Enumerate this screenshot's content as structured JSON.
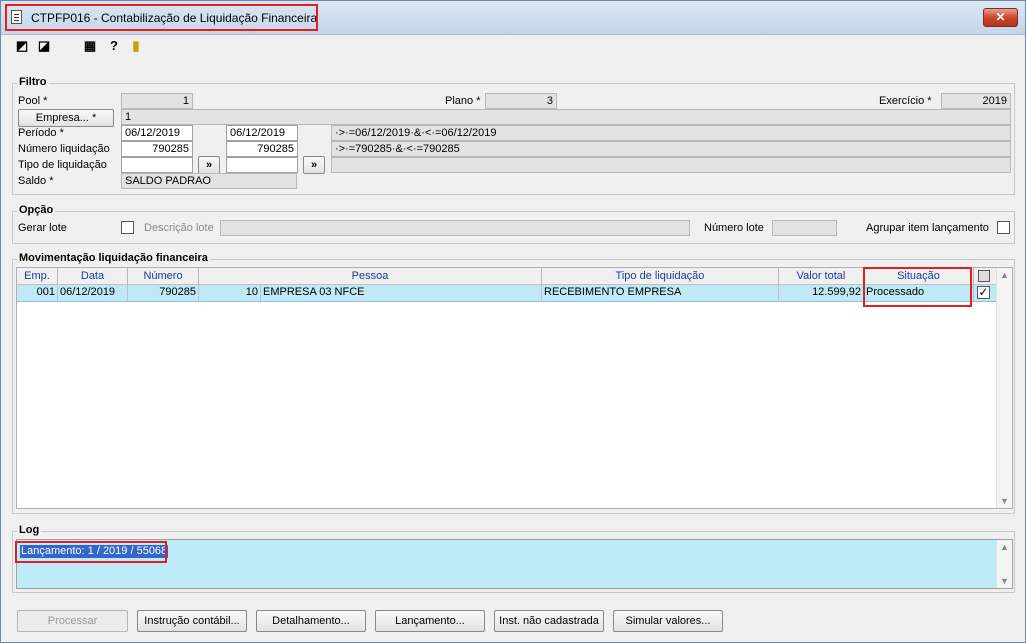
{
  "window": {
    "title": "CTPFP016 - Contabilização de Liquidação Financeira",
    "close_label": "✕"
  },
  "filtro": {
    "title": "Filtro",
    "pool_label": "Pool *",
    "pool_value": "1",
    "plano_label": "Plano *",
    "plano_value": "3",
    "exercicio_label": "Exercício *",
    "exercicio_value": "2019",
    "empresa_button": "Empresa... *",
    "empresa_value": "1",
    "periodo_label": "Período *",
    "periodo_from": "06/12/2019",
    "periodo_to": "06/12/2019",
    "periodo_expr": "·>·=06/12/2019·&·<·=06/12/2019",
    "numero_label": "Número liquidação",
    "numero_from": "790285",
    "numero_to": "790285",
    "numero_expr": "·>·=790285·&·<·=790285",
    "tipo_label": "Tipo de liquidação",
    "tipo_from": "",
    "tipo_to": "",
    "picker_label": "»",
    "saldo_label": "Saldo *",
    "saldo_value": "SALDO PADRAO"
  },
  "opcao": {
    "title": "Opção",
    "gerar_lote_label": "Gerar lote",
    "descricao_lote_label": "Descrição lote",
    "descricao_lote_value": "",
    "numero_lote_label": "Número lote",
    "numero_lote_value": "",
    "agrupar_label": "Agrupar item lançamento"
  },
  "movimentacao": {
    "title": "Movimentação liquidação financeira",
    "columns": [
      "Emp.",
      "Data",
      "Número",
      "Pessoa",
      "Tipo de liquidação",
      "Valor total",
      "Situação"
    ],
    "rows": [
      {
        "emp": "001",
        "data": "06/12/2019",
        "numero": "790285",
        "pessoa_cod": "10",
        "pessoa_nome": "EMPRESA 03 NFCE",
        "tipo": "RECEBIMENTO EMPRESA",
        "valor": "12.599,92",
        "situacao": "Processado",
        "checked": "✓"
      }
    ]
  },
  "log": {
    "title": "Log",
    "lines": [
      "Lançamento: 1 / 2019 / 55068"
    ]
  },
  "buttons": {
    "processar": "Processar",
    "instrucao": "Instrução contábil...",
    "detalhamento": "Detalhamento...",
    "lancamento": "Lançamento...",
    "inst_nao_cadastrada": "Inst. não cadastrada",
    "simular": "Simular valores..."
  },
  "toolbar_icons": [
    "first-record-icon",
    "last-record-icon",
    "calendar-icon",
    "help-icon",
    "exit-door-icon"
  ],
  "colors": {
    "grid_selected": "#bfe9f7",
    "highlight": "#e02020",
    "log_selection": "#3366cc"
  }
}
